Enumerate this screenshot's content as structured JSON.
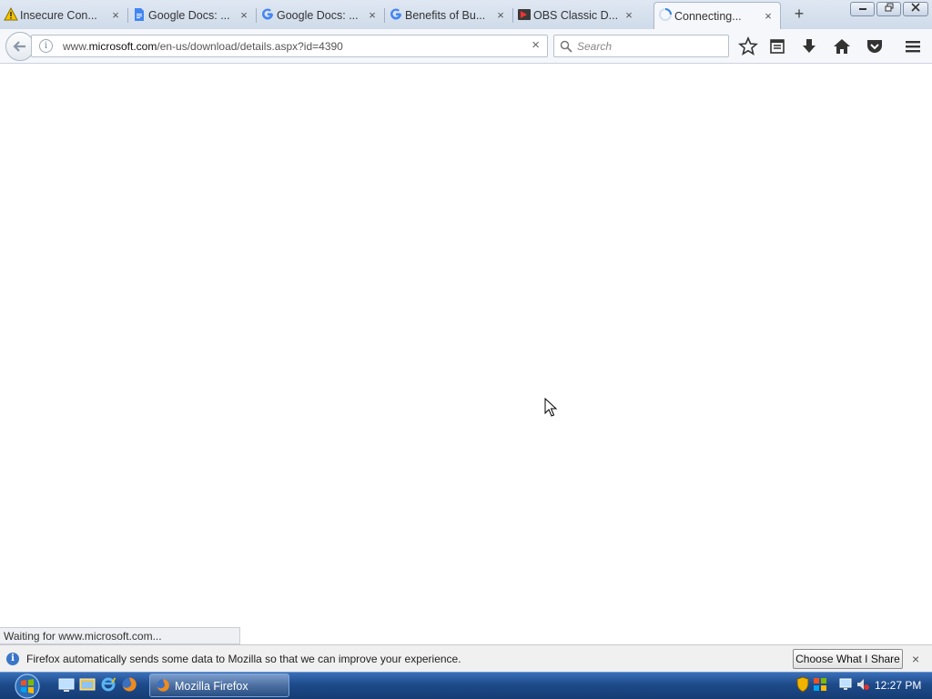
{
  "tabs": [
    {
      "label": "Insecure Con...",
      "icon": "warning-icon"
    },
    {
      "label": "Google Docs: ...",
      "icon": "google-docs-icon"
    },
    {
      "label": "Google Docs: ...",
      "icon": "google-icon"
    },
    {
      "label": "Benefits of Bu...",
      "icon": "google-icon"
    },
    {
      "label": "OBS Classic D...",
      "icon": "obs-icon"
    },
    {
      "label": "Connecting...",
      "icon": "loading-spinner-icon",
      "active": true
    }
  ],
  "close_glyph": "×",
  "newtab_glyph": "+",
  "navbar": {
    "url_domain_prefix": "www.",
    "url_domain": "microsoft.com",
    "url_path": "/en-us/download/details.aspx?id=4390",
    "search_placeholder": "Search",
    "info_glyph": "i",
    "stop_glyph": "×"
  },
  "status_text": "Waiting for www.microsoft.com...",
  "notification": {
    "text": "Firefox automatically sends some data to Mozilla so that we can improve your experience.",
    "button_label": "Choose What I Share",
    "info_glyph": "i",
    "close_glyph": "×"
  },
  "taskbar": {
    "app_button_label": "Mozilla Firefox",
    "clock": "12:27 PM"
  },
  "colors": {
    "taskbar": "#1d4a8a",
    "tabstrip": "#dfe7f2",
    "accent": "#3a76c8"
  }
}
